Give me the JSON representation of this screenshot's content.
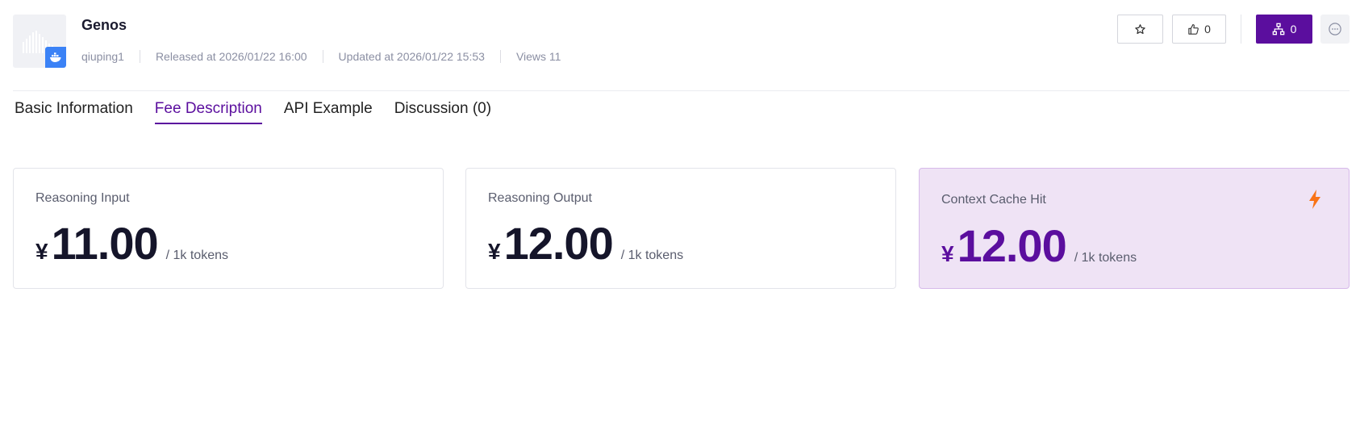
{
  "model": {
    "name": "Genos",
    "author": "qiuping1",
    "released": "Released at 2026/01/22 16:00",
    "updated": "Updated at 2026/01/22 15:53",
    "views": "Views 11"
  },
  "actions": {
    "like_count": "0",
    "fork_count": "0"
  },
  "tabs": [
    {
      "label": "Basic Information",
      "active": false
    },
    {
      "label": "Fee Description",
      "active": true
    },
    {
      "label": "API Example",
      "active": false
    },
    {
      "label": "Discussion (0)",
      "active": false
    }
  ],
  "fees": [
    {
      "label": "Reasoning Input",
      "currency": "¥",
      "amount": "11.00",
      "unit": "/ 1k tokens"
    },
    {
      "label": "Reasoning Output",
      "currency": "¥",
      "amount": "12.00",
      "unit": "/ 1k tokens"
    },
    {
      "label": "Context Cache Hit",
      "currency": "¥",
      "amount": "12.00",
      "unit": "/ 1k tokens"
    }
  ],
  "icons": {
    "thumbnail_badge": "docker-icon",
    "star": "star-icon",
    "like": "thumbs-up-icon",
    "fork": "fork-icon",
    "more": "more-icon",
    "cache": "lightning-icon"
  },
  "colors": {
    "accent": "#5b0e9e",
    "highlight_card_bg": "#efe3f5",
    "badge_blue": "#3b82f6",
    "lightning": "#f97316"
  }
}
